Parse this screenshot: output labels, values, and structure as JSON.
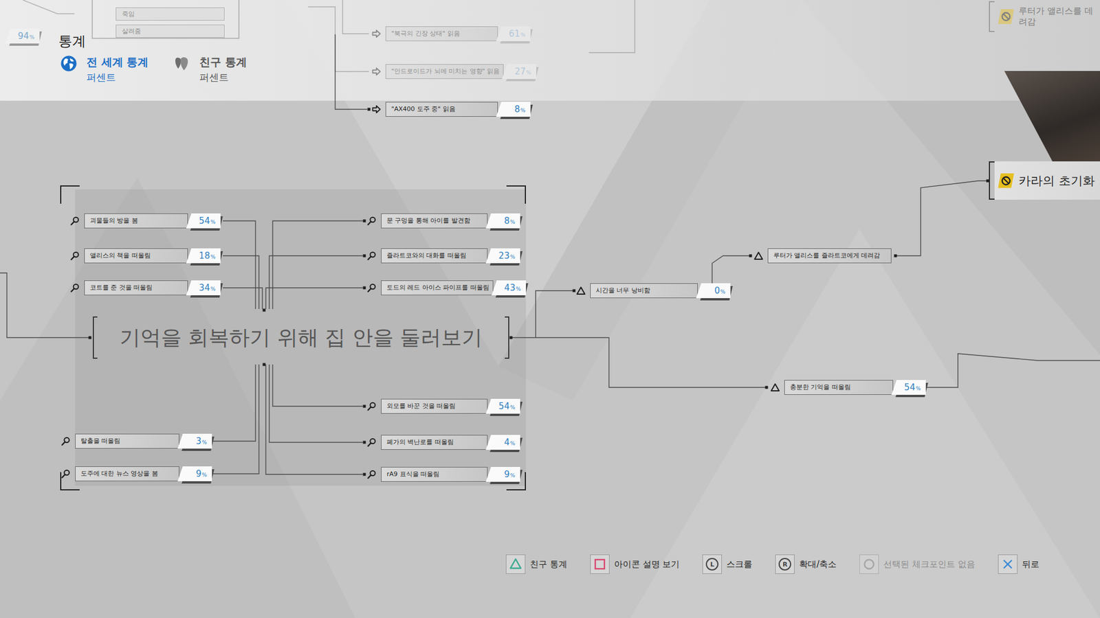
{
  "screen": {
    "title": "통계",
    "badge": {
      "value": "94",
      "unit": "%",
      "faded": true
    }
  },
  "tabs": [
    {
      "label": "전 세계 통계",
      "sub": "퍼센트",
      "selected": true
    },
    {
      "label": "친구 통계",
      "sub": "퍼센트",
      "selected": false
    }
  ],
  "faded_nodes": [
    {
      "label": "죽임",
      "faded": true
    },
    {
      "label": "살려줌",
      "faded": true
    }
  ],
  "read_nodes": [
    {
      "kind": "read",
      "label": "\"북극의 긴장 상태\" 읽음",
      "percent": "61",
      "unit": "%",
      "faded": true
    },
    {
      "kind": "read",
      "label": "\"안드로이드가 뇌에 미치는 영향\" 읽음",
      "percent": "27",
      "unit": "%",
      "faded": true
    },
    {
      "kind": "read",
      "label": "\"AX400 도주 중\" 읽음",
      "percent": "8",
      "unit": "%",
      "faded": false
    }
  ],
  "section": {
    "title": "기억을 회복하기 위해 집 안을 둘러보기",
    "upper_left": [
      {
        "kind": "clue",
        "label": "괴물들의 방을 봄",
        "percent": "54",
        "unit": "%",
        "faded": false
      },
      {
        "kind": "clue",
        "label": "앨리스의 책을 떠올림",
        "percent": "18",
        "unit": "%",
        "faded": false
      },
      {
        "kind": "clue",
        "label": "코트를 준 것을 떠올림",
        "percent": "34",
        "unit": "%",
        "faded": false
      }
    ],
    "upper_right": [
      {
        "kind": "clue",
        "label": "문 구멍을 통해 아이를 발견함",
        "percent": "8",
        "unit": "%",
        "faded": false
      },
      {
        "kind": "clue",
        "label": "즐라트코와의 대화를 떠올림",
        "percent": "23",
        "unit": "%",
        "faded": false
      },
      {
        "kind": "clue",
        "label": "토드의 레드 아이스 파이프를 떠올림",
        "percent": "43",
        "unit": "%",
        "faded": false
      }
    ],
    "lower_left": [
      {
        "kind": "clue",
        "label": "탈출을 떠올림",
        "percent": "3",
        "unit": "%",
        "faded": false
      },
      {
        "kind": "clue",
        "label": "도주에 대한 뉴스 영상을 봄",
        "percent": "9",
        "unit": "%",
        "faded": false
      }
    ],
    "lower_right": [
      {
        "kind": "clue",
        "label": "외모를 바꾼 것을 떠올림",
        "percent": "54",
        "unit": "%",
        "faded": false
      },
      {
        "kind": "clue",
        "label": "폐가의 벽난로를 떠올림",
        "percent": "4",
        "unit": "%",
        "faded": false
      },
      {
        "kind": "clue",
        "label": "rA9 표식을 떠올림",
        "percent": "9",
        "unit": "%",
        "faded": false
      }
    ]
  },
  "outcomes": [
    {
      "kind": "decision",
      "label": "시간을 너무 낭비함",
      "percent": "0",
      "unit": "%",
      "faded": false
    },
    {
      "kind": "decision",
      "label": "충분한 기억을 떠올림",
      "percent": "54",
      "unit": "%",
      "faded": false
    },
    {
      "kind": "decision",
      "label": "루터가 앨리스를 즐라트코에게 데려감",
      "faded": false
    }
  ],
  "endings": [
    {
      "label": "카라의 초기화",
      "faded": false
    },
    {
      "label": "루터가 앨리스를 데려감",
      "faded": true
    }
  ],
  "controls": [
    {
      "kind": "triangle",
      "label": "친구 통계",
      "color": "#3aa98f",
      "disabled": false
    },
    {
      "kind": "square",
      "label": "아이콘 설명 보기",
      "color": "#d9466e",
      "disabled": false
    },
    {
      "kind": "stick",
      "glyph": "L",
      "label": "스크롤",
      "color": "#444444",
      "disabled": false
    },
    {
      "kind": "stick",
      "glyph": "R",
      "label": "확대/축소",
      "color": "#444444",
      "disabled": false
    },
    {
      "kind": "circle",
      "label": "선택된 체크포인트 없음",
      "color": "#8c8c8c",
      "disabled": true
    },
    {
      "kind": "cross",
      "label": "뒤로",
      "color": "#3a8ad6",
      "disabled": false
    }
  ]
}
